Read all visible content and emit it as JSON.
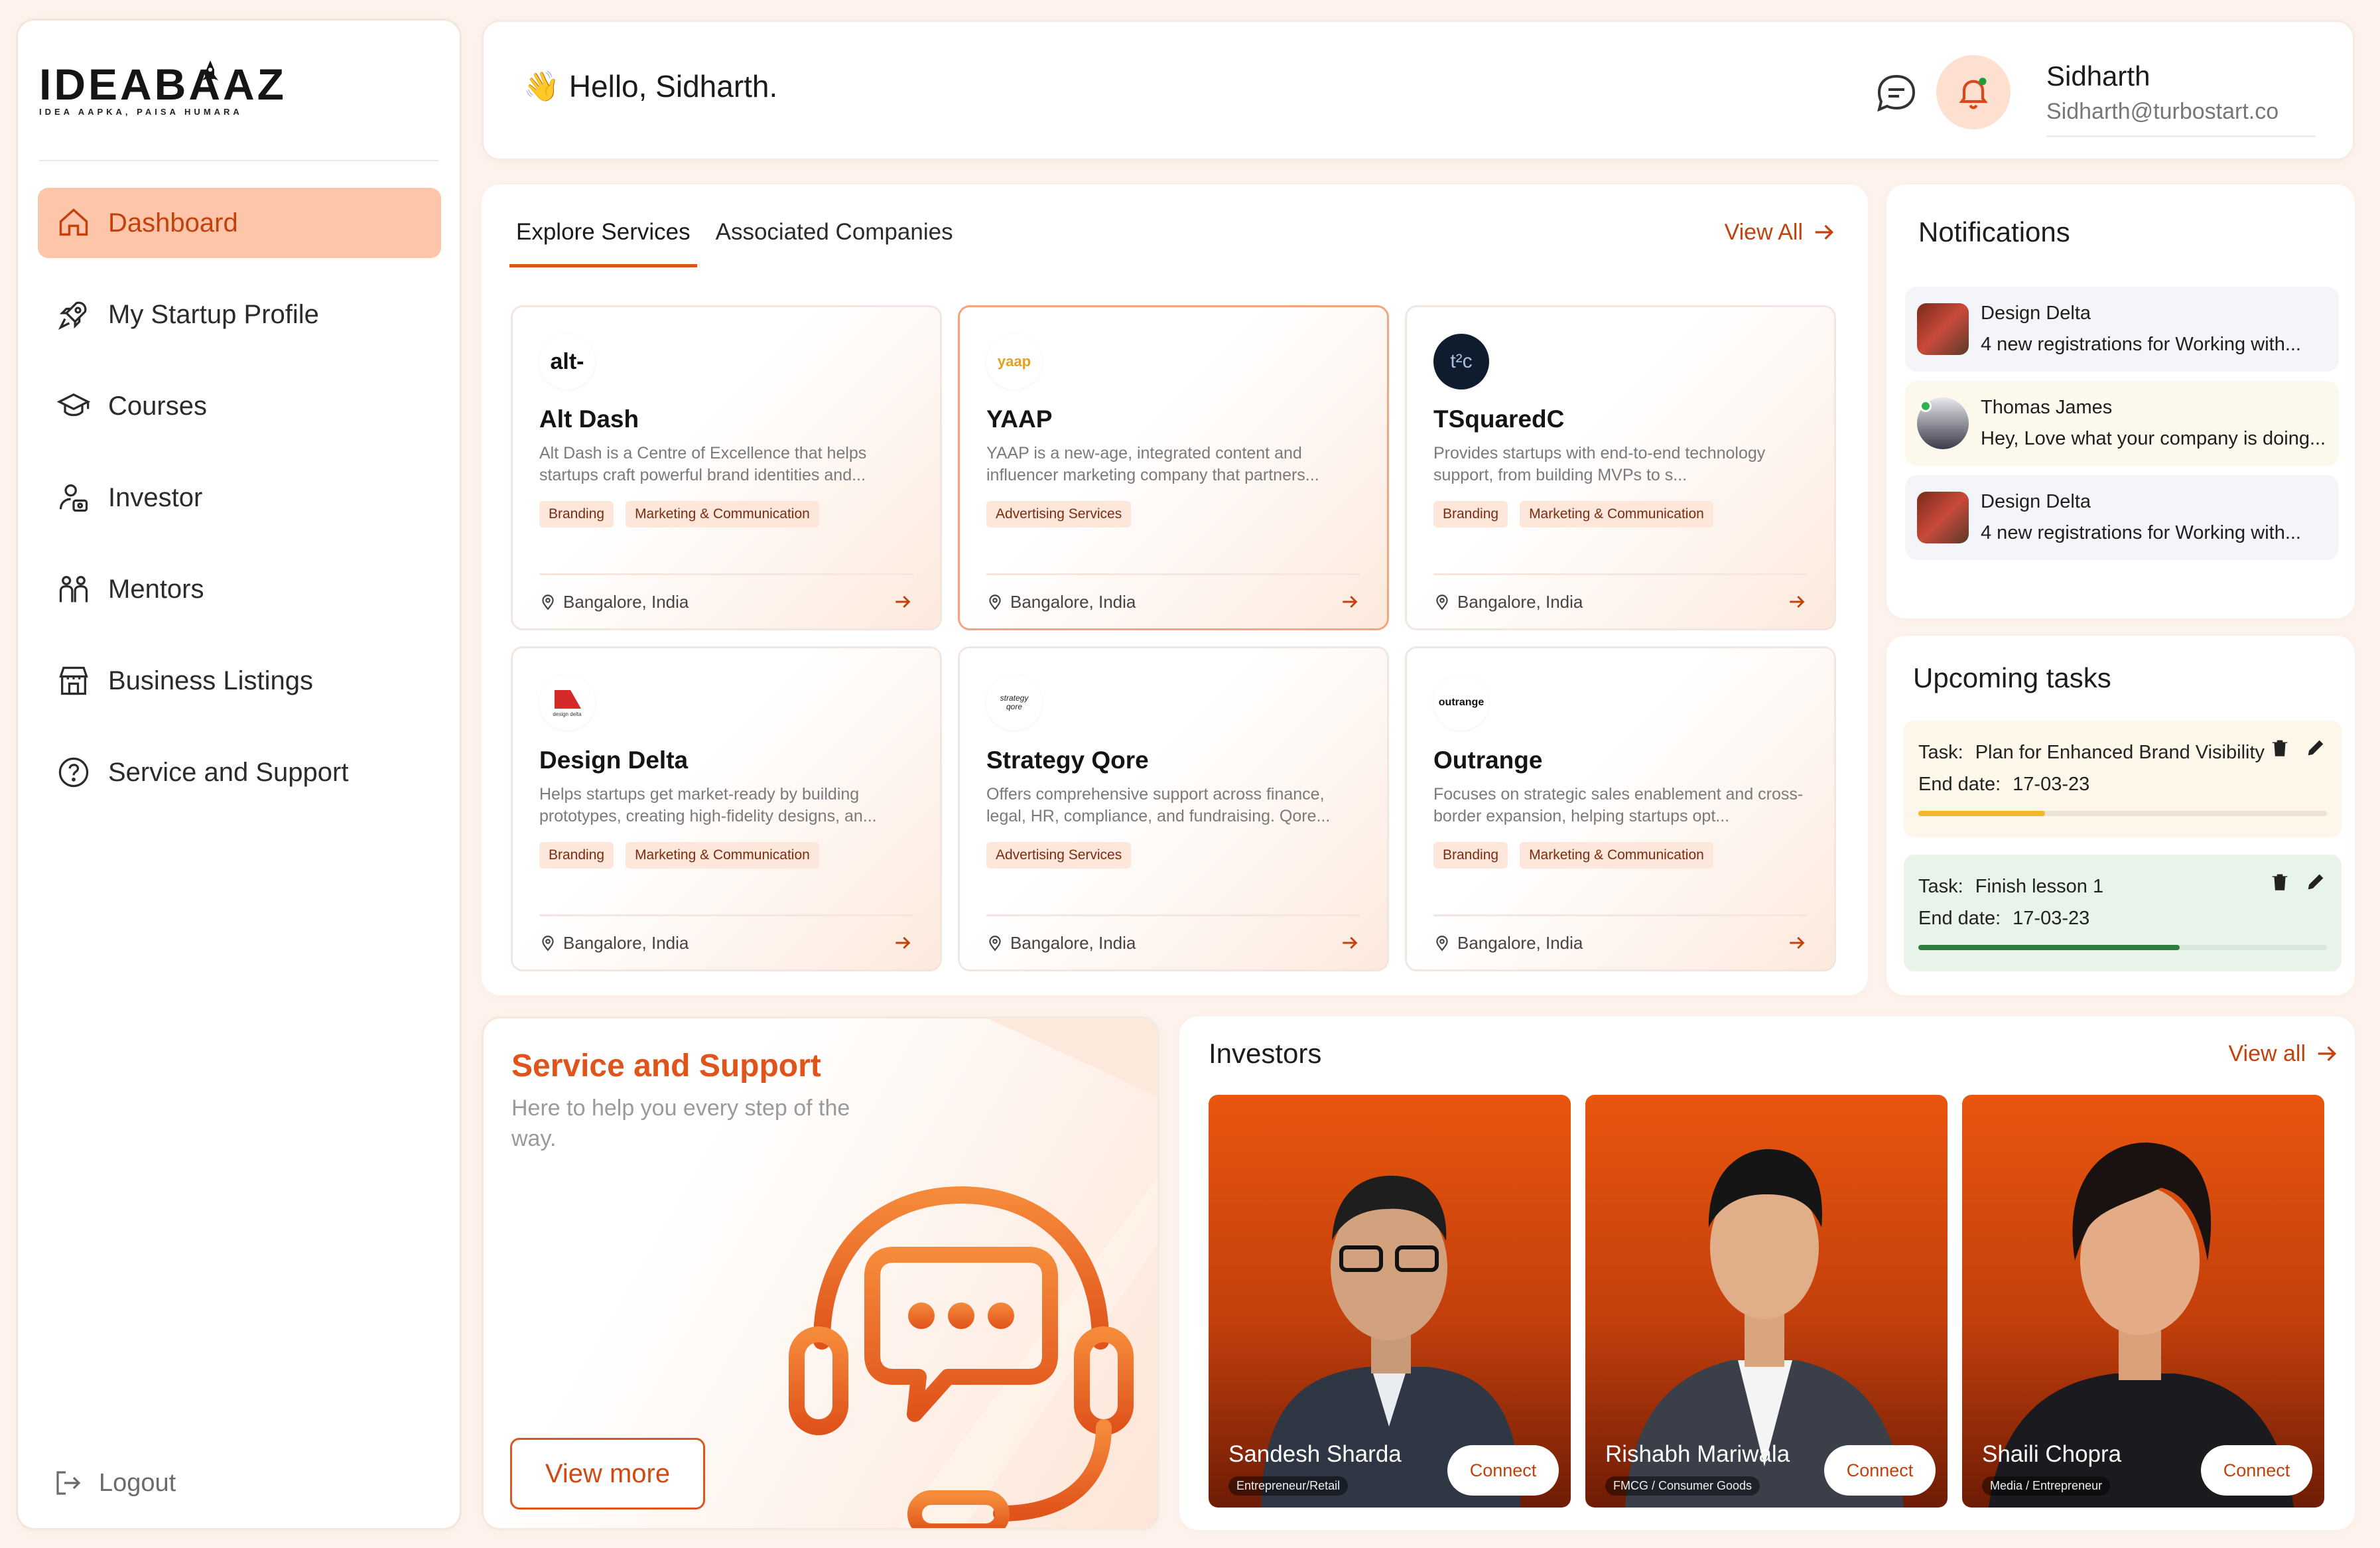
{
  "brand": {
    "logo_text": "IDEABAAZ",
    "tagline": "IDEA AAPKA, PAISA HUMARA",
    "accent": "#e0531b",
    "accent_light": "#fdc6aa"
  },
  "sidebar": {
    "items": [
      {
        "label": "Dashboard",
        "icon": "home-icon",
        "active": true
      },
      {
        "label": "My Startup Profile",
        "icon": "rocket-icon"
      },
      {
        "label": "Courses",
        "icon": "graduation-cap-icon"
      },
      {
        "label": "Investor",
        "icon": "investor-icon"
      },
      {
        "label": "Mentors",
        "icon": "mentors-icon"
      },
      {
        "label": "Business Listings",
        "icon": "store-icon"
      },
      {
        "label": "Service and Support",
        "icon": "help-circle-icon"
      }
    ],
    "logout_label": "Logout"
  },
  "header": {
    "wave": "👋",
    "greeting": "Hello, Sidharth.",
    "user_name": "Sidharth",
    "user_email": "Sidharth@turbostart.co"
  },
  "services": {
    "tabs": [
      "Explore Services",
      "Associated Companies"
    ],
    "active_tab": "Explore Services",
    "view_all_label": "View All",
    "cards": [
      {
        "name": "Alt Dash",
        "logo": "alt-",
        "desc": "Alt Dash is a Centre of Excellence that helps startups craft powerful brand identities and...",
        "tags": [
          "Branding",
          "Marketing & Communication"
        ],
        "location": "Bangalore, India"
      },
      {
        "name": "YAAP",
        "logo": "yaap",
        "desc": "YAAP is a new-age, integrated content and influencer marketing company that partners...",
        "tags": [
          "Advertising Services"
        ],
        "location": "Bangalore, India"
      },
      {
        "name": "TSquaredC",
        "logo": "t²c",
        "desc": "Provides startups with end-to-end technology support, from building MVPs to s...",
        "tags": [
          "Branding",
          "Marketing & Communication"
        ],
        "location": "Bangalore, India"
      },
      {
        "name": "Design Delta",
        "logo": "design delta",
        "desc": "Helps startups get market-ready by building prototypes, creating high-fidelity designs, an...",
        "tags": [
          "Branding",
          "Marketing & Communication"
        ],
        "location": "Bangalore, India"
      },
      {
        "name": "Strategy Qore",
        "logo": "strategy qore",
        "desc": "Offers comprehensive support across finance, legal, HR, compliance, and fundraising. Qore...",
        "tags": [
          "Advertising Services"
        ],
        "location": "Bangalore, India"
      },
      {
        "name": "Outrange",
        "logo": "outrange",
        "desc": "Focuses on strategic sales enablement and cross-border expansion, helping startups opt...",
        "tags": [
          "Branding",
          "Marketing & Communication"
        ],
        "location": "Bangalore, India"
      }
    ]
  },
  "notifications": {
    "title": "Notifications",
    "items": [
      {
        "name": "Design Delta",
        "text": "4 new registrations for  Working with...",
        "bg": "#f4f5f8"
      },
      {
        "name": "Thomas James",
        "text": "Hey, Love what your company is doing...",
        "bg": "#fdf8ec"
      },
      {
        "name": "Design Delta",
        "text": "4 new registrations for  Working with...",
        "bg": "#f4f5f8"
      }
    ]
  },
  "tasks": {
    "title": "Upcoming tasks",
    "task_label": "Task:",
    "end_label": "End date:",
    "items": [
      {
        "task": "Plan for Enhanced Brand Visibility",
        "end": "17-03-23",
        "progress": 0.31,
        "bg": "#fdf7ea",
        "bar": "#f2b82b"
      },
      {
        "task": "Finish lesson 1",
        "end": "17-03-23",
        "progress": 0.64,
        "bg": "#e8f3ea",
        "bar": "#2f7d3a"
      }
    ]
  },
  "support": {
    "title": "Service and Support",
    "subtitle": "Here to help you every step of the way.",
    "button": "View more"
  },
  "investors": {
    "title": "Investors",
    "view_all_label": "View all",
    "connect_label": "Connect",
    "items": [
      {
        "name": "Sandesh Sharda",
        "role": "Entrepreneur/Retail"
      },
      {
        "name": "Rishabh Mariwala",
        "role": "FMCG / Consumer Goods"
      },
      {
        "name": "Shaili Chopra",
        "role": "Media / Entrepreneur"
      }
    ]
  }
}
